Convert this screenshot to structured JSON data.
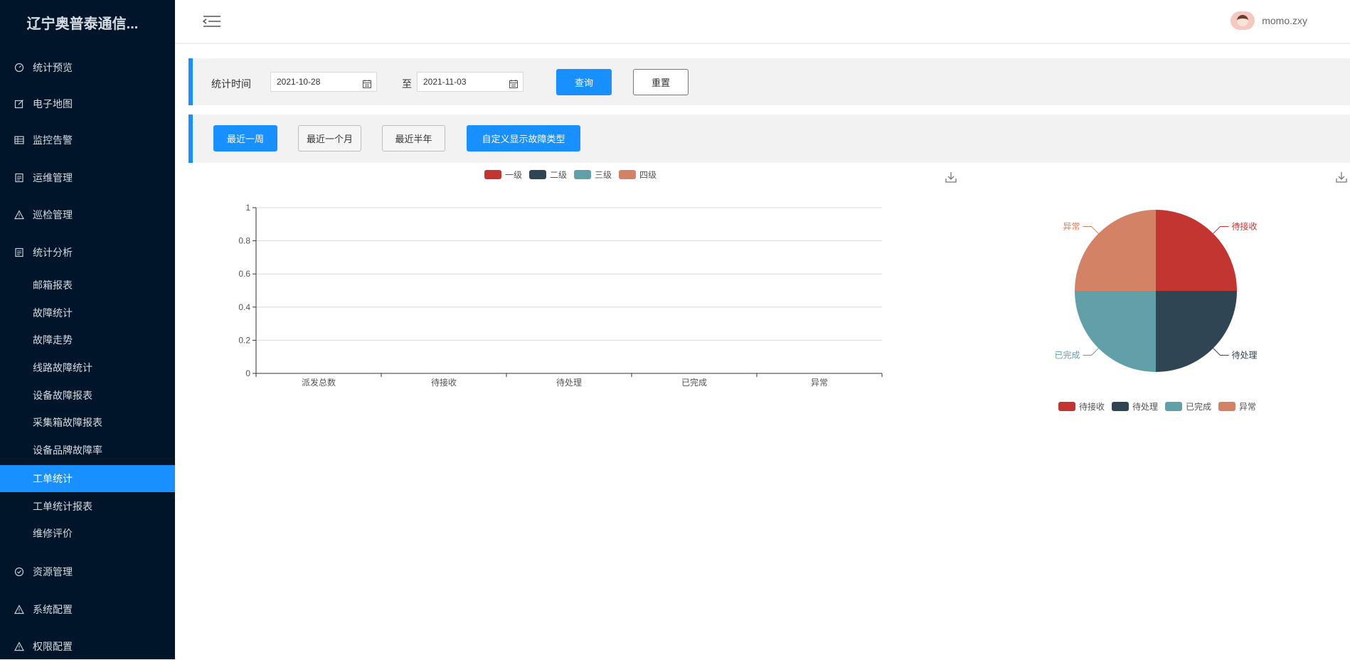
{
  "brand": "辽宁奥普泰通信...",
  "nav": {
    "stats_preview": "统计预览",
    "emap": "电子地图",
    "monitor_alarm": "监控告警",
    "ops": "运维管理",
    "patrol": "巡检管理",
    "analysis": "统计分析",
    "sub": {
      "mail_report": "邮箱报表",
      "fault_stats": "故障统计",
      "fault_trend": "故障走势",
      "line_fault": "线路故障统计",
      "device_fault": "设备故障报表",
      "box_fault": "采集箱故障报表",
      "brand_fault": "设备品牌故障率",
      "work_order": "工单统计",
      "work_order_report": "工单统计报表",
      "repair_eval": "维修评价"
    },
    "resource": "资源管理",
    "system": "系统配置",
    "permission": "权限配置"
  },
  "user": {
    "name": "momo.zxy"
  },
  "filter": {
    "label": "统计时间",
    "start": "2021-10-28",
    "to": "至",
    "end": "2021-11-03",
    "query": "查询",
    "reset": "重置"
  },
  "quick": {
    "week": "最近一周",
    "month": "最近一个月",
    "half_year": "最近半年",
    "custom": "自定义显示故障类型"
  },
  "colors": {
    "level1": "#c23531",
    "level2": "#2f4554",
    "level3": "#61a0a8",
    "level4": "#d48265",
    "accent": "#1890ff",
    "sidebar": "#001529"
  },
  "chart_data": [
    {
      "type": "bar",
      "categories": [
        "派发总数",
        "待接收",
        "待处理",
        "已完成",
        "异常"
      ],
      "series": [
        {
          "name": "一级",
          "values": [
            0,
            0,
            0,
            0,
            0
          ]
        },
        {
          "name": "二级",
          "values": [
            0,
            0,
            0,
            0,
            0
          ]
        },
        {
          "name": "三级",
          "values": [
            0,
            0,
            0,
            0,
            0
          ]
        },
        {
          "name": "四级",
          "values": [
            0,
            0,
            0,
            0,
            0
          ]
        }
      ],
      "yticks": [
        "0",
        "0.2",
        "0.4",
        "0.6",
        "0.8",
        "1"
      ],
      "ylim": [
        0,
        1
      ],
      "legend": "top",
      "grid": true
    },
    {
      "type": "pie",
      "slices": [
        {
          "name": "待接收",
          "value": 1
        },
        {
          "name": "待处理",
          "value": 1
        },
        {
          "name": "已完成",
          "value": 1
        },
        {
          "name": "异常",
          "value": 1
        }
      ],
      "legend": "bottom"
    }
  ]
}
